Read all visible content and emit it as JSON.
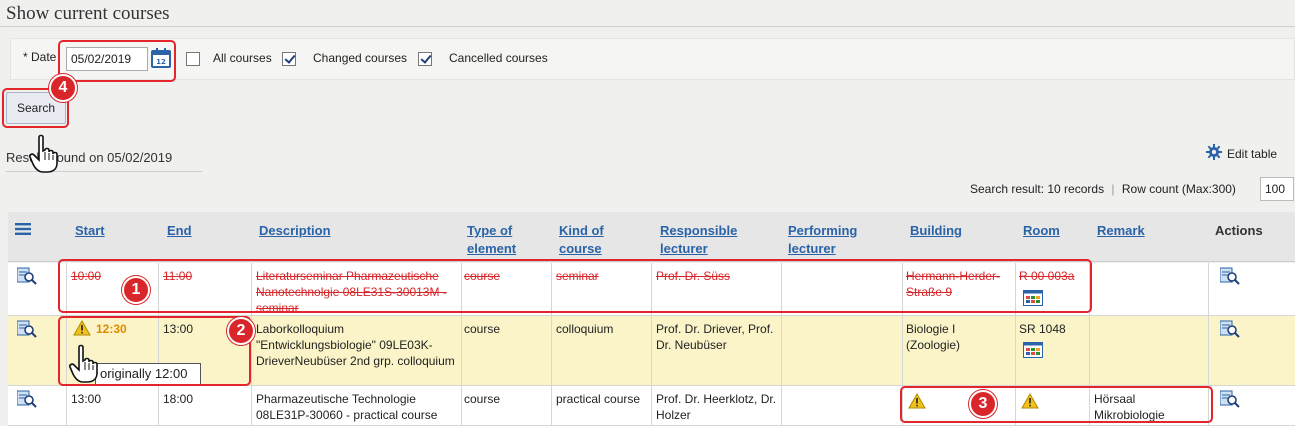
{
  "page": {
    "title": "Show current courses"
  },
  "filter": {
    "date_label": "* Date",
    "date_value": "05/02/2019",
    "all_courses_label": "All courses",
    "changed_courses_label": "Changed courses",
    "cancelled_courses_label": "Cancelled courses",
    "all_courses_checked": false,
    "changed_courses_checked": true,
    "cancelled_courses_checked": true,
    "search_label": "Search"
  },
  "results": {
    "label": "Results found on 05/02/2019",
    "edit_table_label": "Edit table",
    "search_result_text": "Search result: 10 records",
    "row_count_label": "Row count (Max:300)",
    "row_count_value": "100"
  },
  "table": {
    "headers": {
      "start": "Start",
      "end": "End",
      "description": "Description",
      "type_of_element": "Type of element",
      "kind_of_course": "Kind of course",
      "responsible_lecturer": "Responsible lecturer",
      "performing_lecturer": "Performing lecturer",
      "building": "Building",
      "room": "Room",
      "remark": "Remark",
      "actions": "Actions"
    },
    "rows": [
      {
        "status": "cancelled",
        "start": "10:00",
        "end": "11:00",
        "description": "Literaturseminar Pharmazeutische Nanotechnolgie 08LE31S-30013M - seminar",
        "type": "course",
        "kind": "seminar",
        "responsible": "Prof. Dr. Süss",
        "performing": "",
        "building": "Hermann-Herder-Straße 9",
        "room": "R 00 003a",
        "remark": ""
      },
      {
        "status": "changed",
        "start": "12:30",
        "end": "13:00",
        "description": "Laborkolloquium \"Entwicklungsbiologie\" 09LE03K-DrieverNeubüser 2nd grp. colloquium",
        "type": "course",
        "kind": "colloquium",
        "responsible": "Prof. Dr. Driever, Prof. Dr. Neubüser",
        "performing": "",
        "building": "Biologie I (Zoologie)",
        "room": "SR 1048",
        "remark": "",
        "tooltip": "originally 12:00"
      },
      {
        "status": "normal",
        "start": "13:00",
        "end": "18:00",
        "description": "Pharmazeutische Technologie 08LE31P-30060 - practical course",
        "type": "course",
        "kind": "practical course",
        "responsible": "Prof. Dr. Heerklotz, Dr. Holzer",
        "performing": "",
        "building": "",
        "room": "",
        "remark": "Hörsaal Mikrobiologie"
      }
    ]
  },
  "callouts": {
    "one": "1",
    "two": "2",
    "three": "3",
    "four": "4"
  },
  "colors": {
    "highlight": "#e3262c",
    "changed_row": "#faf4c8",
    "link": "#2a63a8",
    "strike": "#d8262a"
  },
  "icons": [
    "calendar-icon",
    "gear-icon",
    "menu-icon",
    "view-details-icon",
    "room-plan-icon",
    "warning-icon",
    "pointer-hand-icon"
  ]
}
